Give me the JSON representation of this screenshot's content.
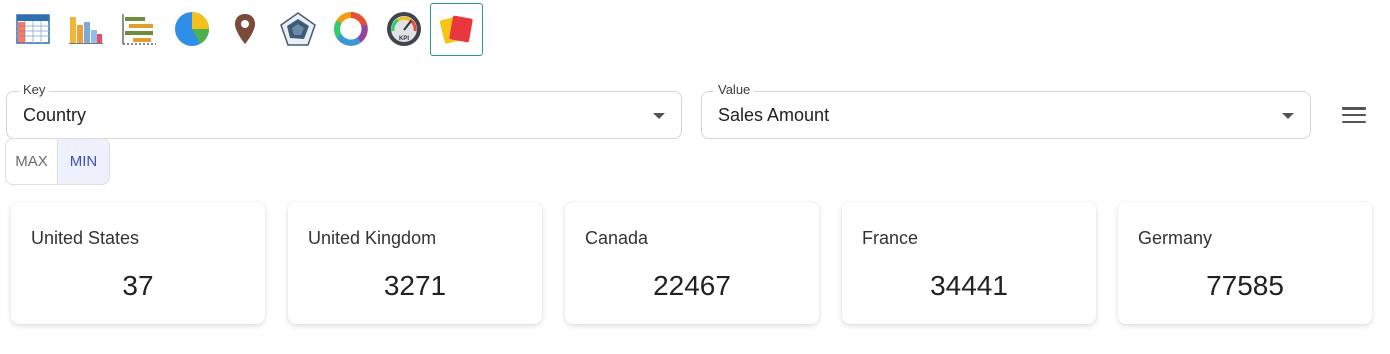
{
  "toolbar": {
    "icons": [
      "table-view-icon",
      "bar-chart-icon",
      "gantt-chart-icon",
      "pie-chart-icon",
      "map-pin-icon",
      "radar-chart-icon",
      "donut-chart-icon",
      "kpi-gauge-icon",
      "cards-view-icon"
    ],
    "active": "cards-view-icon"
  },
  "key_field": {
    "label": "Key",
    "value": "Country"
  },
  "value_field": {
    "label": "Value",
    "value": "Sales Amount"
  },
  "toggle": {
    "max_label": "MAX",
    "min_label": "MIN",
    "selected": "MIN"
  },
  "cards": [
    {
      "title": "United States",
      "value": "37"
    },
    {
      "title": "United Kingdom",
      "value": "3271"
    },
    {
      "title": "Canada",
      "value": "22467"
    },
    {
      "title": "France",
      "value": "34441"
    },
    {
      "title": "Germany",
      "value": "77585"
    }
  ],
  "colors": {
    "accent": "#2a9d7e",
    "selected_toggle_text": "#3f4fc6",
    "selected_toggle_bg": "#eef0fb"
  }
}
